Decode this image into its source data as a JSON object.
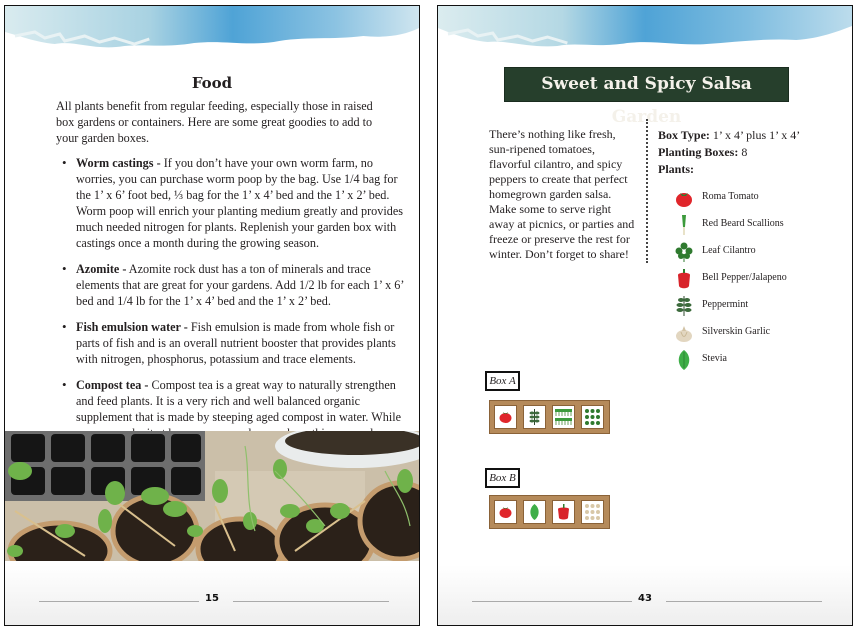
{
  "left_page": {
    "title": "Food",
    "intro": "All plants benefit from regular feeding, especially those in raised box gardens or containers. Here are some great goodies to add to your garden boxes.",
    "items": [
      {
        "term": "Worm castings -",
        "text": " If you don’t have your own worm farm, no worries, you can purchase worm poop by the bag. Use 1/4 bag for the 1’ x 6’ foot bed, ⅓ bag for the 1’ x 4’ bed and the 1’ x 2’ bed. Worm poop will enrich your planting medium greatly and provides much needed nitrogen for plants. Replenish your garden box with castings once a month during the growing season."
      },
      {
        "term": "Azomite -",
        "text": " Azomite rock dust has a ton of minerals and trace elements that are great for your gardens. Add 1/2 lb for each 1’ x 6’ bed and 1/4 lb for the 1’ x 4’ bed and the 1’ x 2’ bed."
      },
      {
        "term": "Fish emulsion water -",
        "text": " Fish emulsion is made from whole fish or parts of fish and is an overall nutrient booster that provides plants with nitrogen, phosphorus, potassium and trace elements."
      },
      {
        "term": "Compost tea -",
        "text": " Compost tea is a great way to naturally strengthen and feed plants. It is a very rich and well balanced organic supplement that is made by steeping aged compost in water. While you can make it at home, you can also purchase this pre-made. Follow package directions for regular feeding."
      }
    ],
    "photo_alt": "seedlings in peat pots and trays",
    "page_number": "15"
  },
  "right_page": {
    "title": "Sweet and Spicy Salsa Garden",
    "description": "There’s nothing like fresh, sun-ripened tomatoes, flavorful cilantro, and spicy peppers to create that perfect homegrown garden salsa. Make some to serve right away at picnics, or parties and freeze or preserve the rest for winter. Don’t forget to share!",
    "box_type_label": "Box Type:",
    "box_type_value": " 1’ x 4’ plus 1’ x 4’",
    "planting_boxes_label": "Planting Boxes:",
    "planting_boxes_value": " 8",
    "plants_label": "Plants:",
    "plants": [
      {
        "name": "Roma Tomato",
        "icon": "tomato-icon"
      },
      {
        "name": "Red Beard Scallions",
        "icon": "scallion-icon"
      },
      {
        "name": "Leaf Cilantro",
        "icon": "cilantro-icon"
      },
      {
        "name": "Bell Pepper/Jalapeno",
        "icon": "pepper-icon"
      },
      {
        "name": "Peppermint",
        "icon": "peppermint-icon"
      },
      {
        "name": "Silverskin Garlic",
        "icon": "garlic-icon"
      },
      {
        "name": "Stevia",
        "icon": "stevia-icon"
      }
    ],
    "boxes": [
      {
        "label": "Box A",
        "cells": [
          "tomato",
          "peppermint",
          "scallions",
          "cilantro"
        ]
      },
      {
        "label": "Box B",
        "cells": [
          "tomato",
          "stevia",
          "pepper",
          "garlic"
        ]
      }
    ],
    "page_number": "43"
  },
  "colors": {
    "banner_bg": "#263f2c",
    "banner_text": "#f4f1ea",
    "wood": "#b58a5a",
    "tomato": "#e0262b",
    "leaf_green": "#3c9a3c"
  }
}
